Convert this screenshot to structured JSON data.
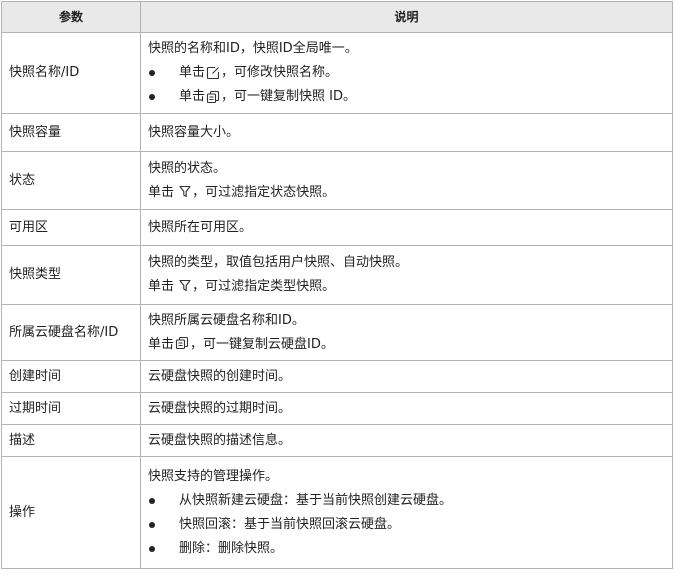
{
  "header": {
    "param": "参数",
    "desc": "说明"
  },
  "rows": {
    "r0": {
      "param": "快照名称/ID",
      "l1": "快照的名称和ID，快照ID全局唯一。",
      "b1a": "单击",
      "b1b": "，可修改快照名称。",
      "b2a": "单击",
      "b2b": "，可一键复制快照 ID。",
      "icons": [
        "edit-icon",
        "copy-icon"
      ]
    },
    "r1": {
      "param": "快照容量",
      "l1": "快照容量大小。"
    },
    "r2": {
      "param": "状态",
      "l1": "快照的状态。",
      "l2a": "单击 ",
      "l2b": "，可过滤指定状态快照。",
      "icons": [
        "filter-icon"
      ]
    },
    "r3": {
      "param": "可用区",
      "l1": "快照所在可用区。"
    },
    "r4": {
      "param": "快照类型",
      "l1": "快照的类型，取值包括用户快照、自动快照。",
      "l2a": "单击 ",
      "l2b": "，可过滤指定类型快照。",
      "icons": [
        "filter-icon"
      ]
    },
    "r5": {
      "param": "所属云硬盘名称/ID",
      "l1": "快照所属云硬盘名称和ID。",
      "l2a": "单击",
      "l2b": "，可一键复制云硬盘ID。",
      "icons": [
        "copy-icon"
      ]
    },
    "r6": {
      "param": "创建时间",
      "l1": "云硬盘快照的创建时间。"
    },
    "r7": {
      "param": "过期时间",
      "l1": "云硬盘快照的过期时间。"
    },
    "r8": {
      "param": "描述",
      "l1": "云硬盘快照的描述信息。"
    },
    "r9": {
      "param": "操作",
      "l1": "快照支持的管理操作。",
      "b1": "从快照新建云硬盘：基于当前快照创建云硬盘。",
      "b2": "快照回滚：基于当前快照回滚云硬盘。",
      "b3": "删除：删除快照。"
    }
  }
}
